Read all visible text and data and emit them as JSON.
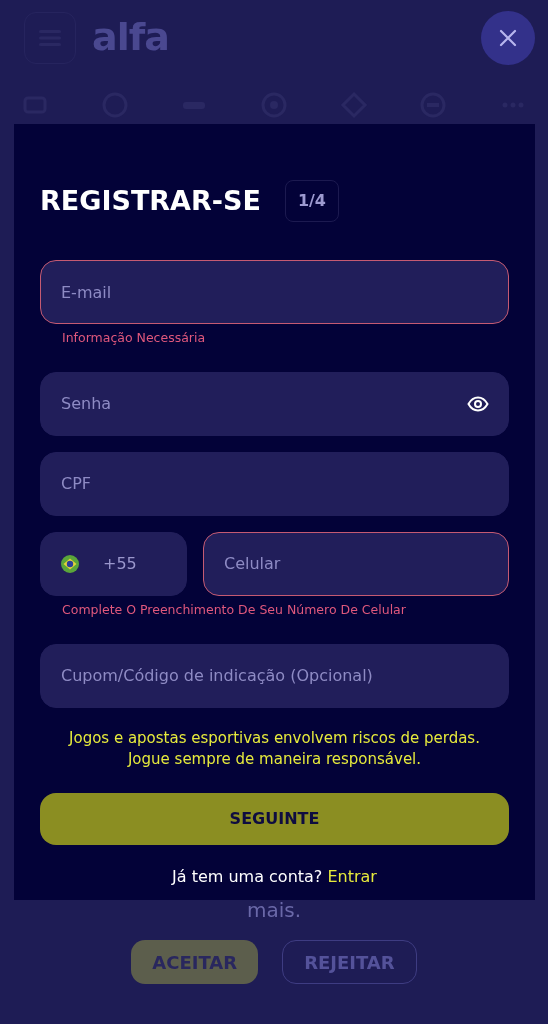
{
  "background": {
    "logo": "alfa",
    "partial_text": "mais.",
    "buttons": [
      {
        "label": "ACEITAR",
        "kind": "primary"
      },
      {
        "label": "REJEITAR",
        "kind": "outline"
      }
    ]
  },
  "modal": {
    "title": "REGISTRAR-SE",
    "step": "1/4",
    "fields": [
      {
        "kind": "text",
        "placeholder": "E-mail",
        "invalid": true,
        "error": "Informação Necessária"
      },
      {
        "kind": "password",
        "placeholder": "Senha",
        "invalid": false
      },
      {
        "kind": "text",
        "placeholder": "CPF",
        "invalid": false
      },
      {
        "kind": "phone",
        "country_code": "+55",
        "placeholder": "Celular",
        "invalid": true,
        "error": "Complete O Preenchimento De Seu Número De Celular"
      },
      {
        "kind": "text",
        "placeholder": "Cupom/Código de indicação (Opcional)",
        "invalid": false
      }
    ],
    "notice_lines": [
      "Jogos e apostas esportivas envolvem riscos de perdas.",
      "Jogue sempre de maneira responsável."
    ],
    "submit": "SEGUINTE",
    "login_prompt": "Já tem uma conta?",
    "login_link": "Entrar"
  }
}
